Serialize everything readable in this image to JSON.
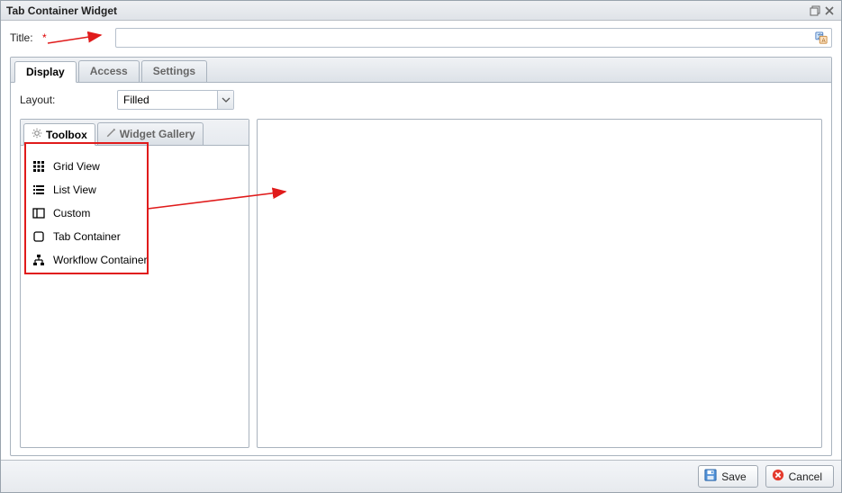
{
  "window": {
    "title": "Tab Container Widget"
  },
  "fields": {
    "title_label": "Title:",
    "title_value": ""
  },
  "tabs": [
    {
      "label": "Display",
      "active": true
    },
    {
      "label": "Access",
      "active": false
    },
    {
      "label": "Settings",
      "active": false
    }
  ],
  "display": {
    "layout_label": "Layout:",
    "layout_value": "Filled",
    "inner_tabs": [
      {
        "label": "Toolbox",
        "active": true,
        "icon": "gear-icon"
      },
      {
        "label": "Widget Gallery",
        "active": false,
        "icon": "wand-icon"
      }
    ],
    "toolbox": {
      "items": [
        {
          "label": "Grid View",
          "icon": "grid-icon"
        },
        {
          "label": "List View",
          "icon": "list-icon"
        },
        {
          "label": "Custom",
          "icon": "columns-icon"
        },
        {
          "label": "Tab Container",
          "icon": "square-icon"
        },
        {
          "label": "Workflow Container",
          "icon": "hierarchy-icon"
        }
      ]
    }
  },
  "footer": {
    "save": "Save",
    "cancel": "Cancel"
  }
}
